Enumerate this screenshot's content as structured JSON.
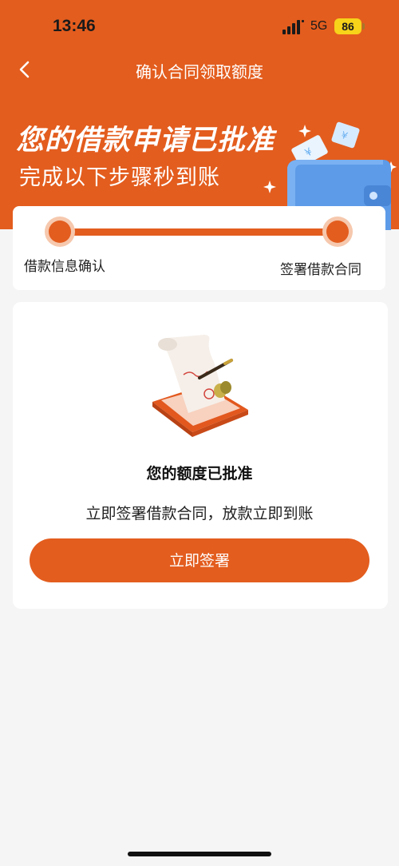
{
  "status_bar": {
    "time": "13:46",
    "network": "5G",
    "battery": "86"
  },
  "nav": {
    "title": "确认合同领取额度"
  },
  "banner": {
    "title": "您的借款申请已批准",
    "subtitle": "完成以下步骤秒到账"
  },
  "progress": {
    "steps": [
      {
        "label": "借款信息确认"
      },
      {
        "label": "签署借款合同"
      }
    ]
  },
  "main": {
    "title": "您的额度已批准",
    "description": "立即签署借款合同，放款立即到账",
    "button_label": "立即签署"
  },
  "icons": {
    "back": "chevron-left-icon",
    "signal": "signal-icon",
    "wallet": "wallet-illustration",
    "contract": "contract-illustration"
  },
  "colors": {
    "accent": "#e35d1e",
    "accent_light": "#f6c8ad",
    "battery": "#f7d31a",
    "background": "#f5f5f5"
  }
}
